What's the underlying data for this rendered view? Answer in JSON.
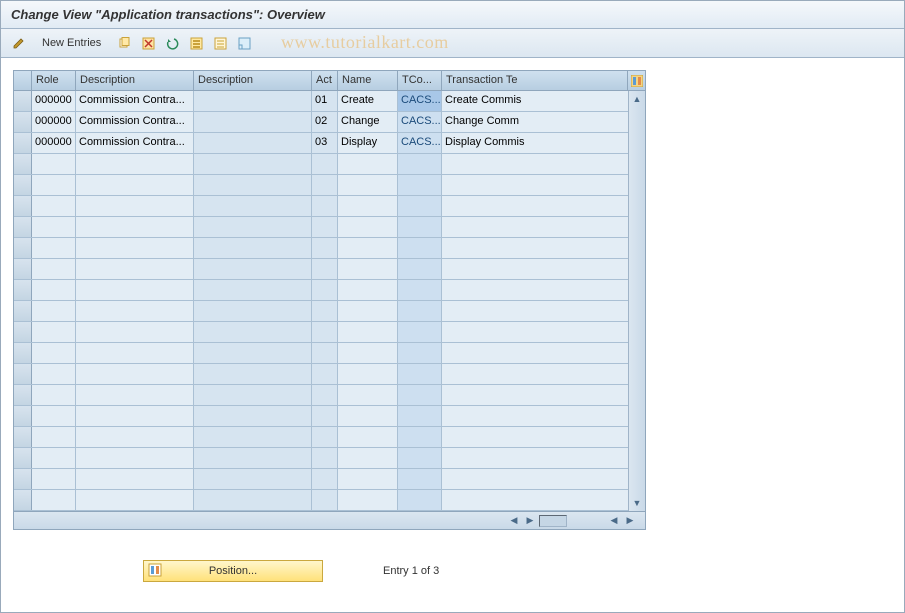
{
  "title": "Change View \"Application transactions\": Overview",
  "watermark": "www.tutorialkart.com",
  "toolbar": {
    "new_entries": "New Entries"
  },
  "columns": {
    "role": "Role",
    "desc1": "Description",
    "desc2": "Description",
    "act": "Act",
    "name": "Name",
    "tcode": "TCo...",
    "trtext": "Transaction Te"
  },
  "rows": [
    {
      "role": "000000",
      "desc1": "Commission Contra...",
      "desc2": "",
      "act": "01",
      "name": "Create",
      "tcode": "CACS...",
      "trtext": "Create Commis",
      "hl": true
    },
    {
      "role": "000000",
      "desc1": "Commission Contra...",
      "desc2": "",
      "act": "02",
      "name": "Change",
      "tcode": "CACS...",
      "trtext": "Change Comm"
    },
    {
      "role": "000000",
      "desc1": "Commission Contra...",
      "desc2": "",
      "act": "03",
      "name": "Display",
      "tcode": "CACS...",
      "trtext": "Display Commis"
    }
  ],
  "footer": {
    "position_label": "Position...",
    "entry_text": "Entry 1 of 3"
  }
}
